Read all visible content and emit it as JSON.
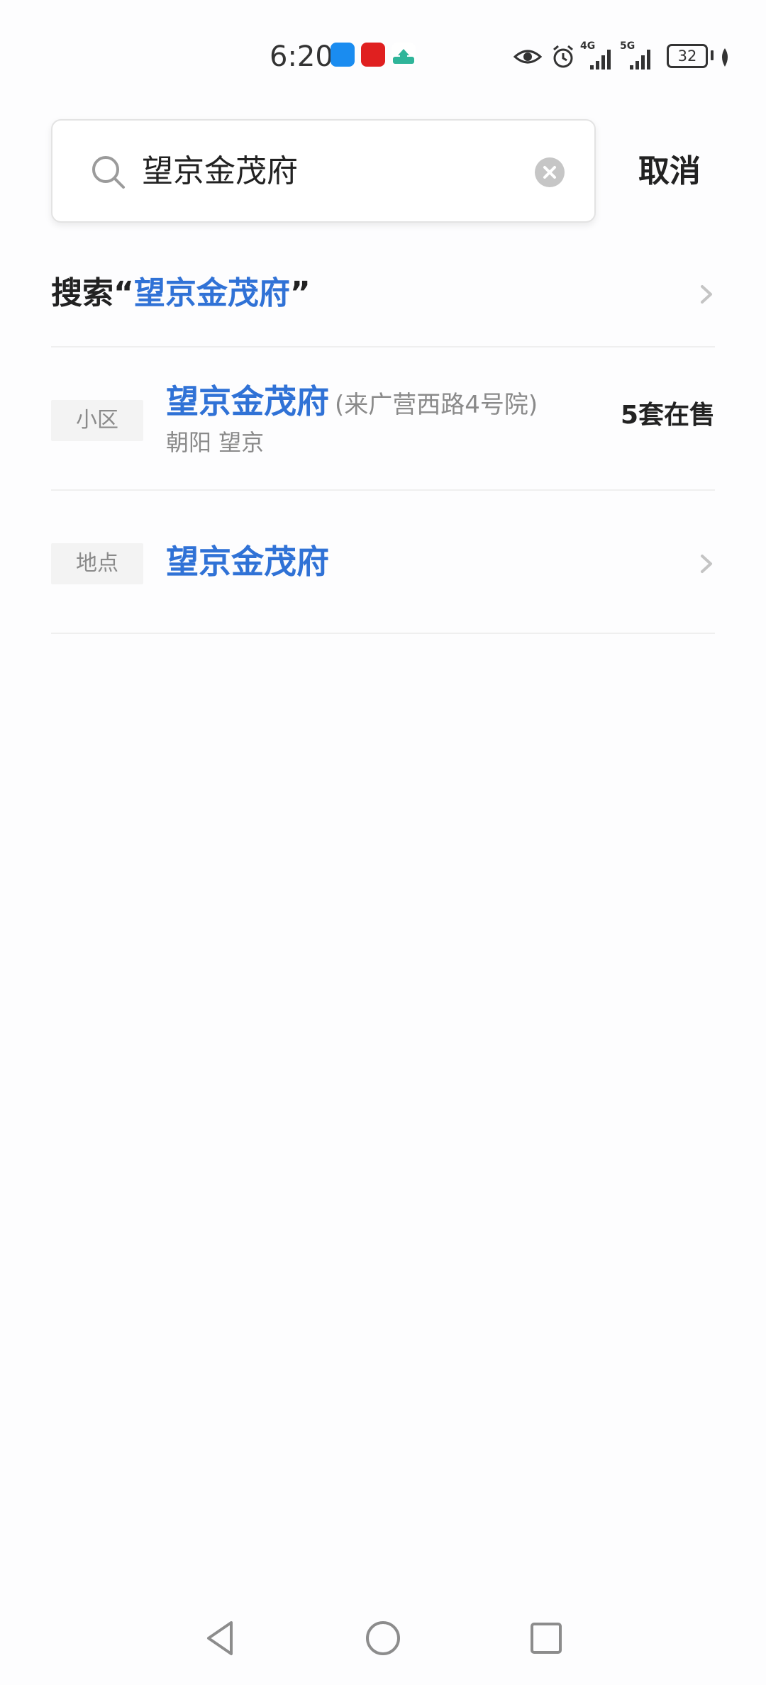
{
  "status_bar": {
    "time": "6:20",
    "network_4g": "4G",
    "network_5g": "5G",
    "battery": "32"
  },
  "search": {
    "query": "望京金茂府",
    "cancel_label": "取消"
  },
  "search_all": {
    "prefix": "搜索“",
    "keyword": "望京金茂府",
    "suffix": "”"
  },
  "results": [
    {
      "tag": "小区",
      "title": "望京金茂府",
      "address": "(来广营西路4号院)",
      "district": "朝阳 望京",
      "count": "5套在售"
    },
    {
      "tag": "地点",
      "title": "望京金茂府"
    }
  ],
  "colors": {
    "highlight": "#3072d6",
    "tag_background": "#f3f3f3",
    "divider": "#efefef"
  },
  "icons": {
    "search": "search-icon",
    "clear": "clear-icon",
    "chevron": "chevron-right-icon",
    "nav_back": "triangle-back-icon",
    "nav_home": "circle-home-icon",
    "nav_recent": "square-recent-icon"
  }
}
